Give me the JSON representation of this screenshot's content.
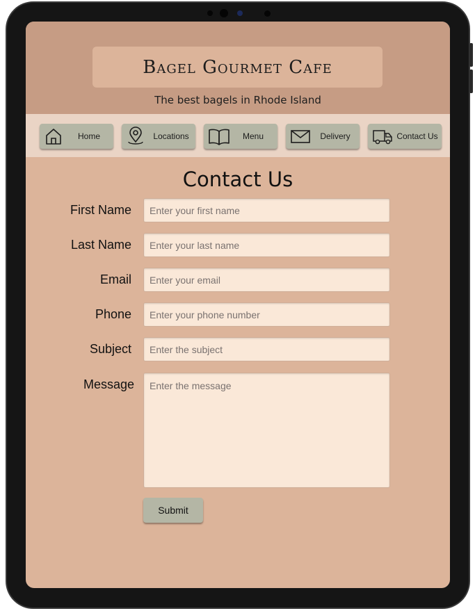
{
  "brand": {
    "title": "Bagel Gourmet Cafe",
    "tagline": "The best bagels in Rhode Island"
  },
  "nav": {
    "items": [
      {
        "label": "Home",
        "icon": "home-icon"
      },
      {
        "label": "Locations",
        "icon": "location-pin-icon"
      },
      {
        "label": "Menu",
        "icon": "open-book-icon"
      },
      {
        "label": "Delivery",
        "icon": "envelope-icon"
      },
      {
        "label": "Contact Us",
        "icon": "truck-icon"
      }
    ]
  },
  "page": {
    "title": "Contact Us"
  },
  "form": {
    "first_name": {
      "label": "First Name",
      "placeholder": "Enter your first name"
    },
    "last_name": {
      "label": "Last Name",
      "placeholder": "Enter your last name"
    },
    "email": {
      "label": "Email",
      "placeholder": "Enter your email"
    },
    "phone": {
      "label": "Phone",
      "placeholder": "Enter your phone number"
    },
    "subject": {
      "label": "Subject",
      "placeholder": "Enter the subject"
    },
    "message": {
      "label": "Message",
      "placeholder": "Enter the message"
    },
    "submit_label": "Submit"
  },
  "colors": {
    "header_bg": "#c69c84",
    "page_bg": "#dcb49a",
    "nav_bg": "#ead4c5",
    "button_bg": "#b4b6a5",
    "input_bg": "#fae8d8"
  }
}
